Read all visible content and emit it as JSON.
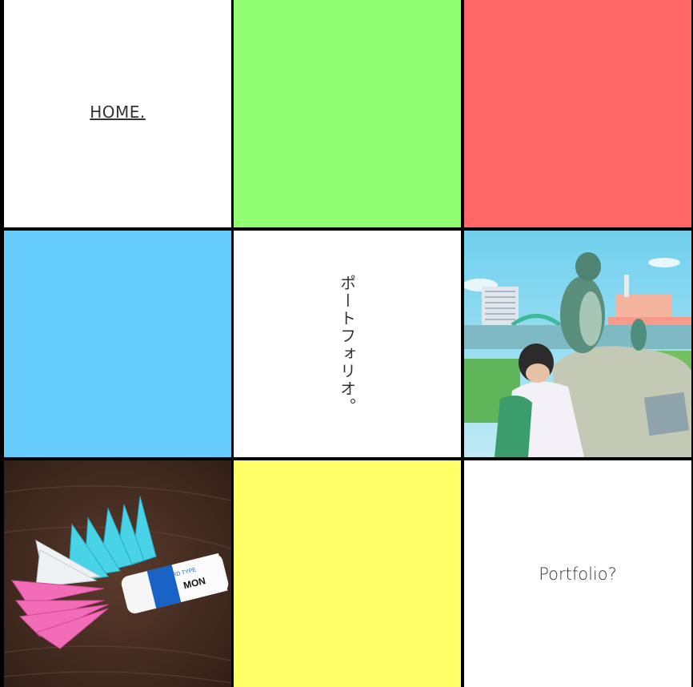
{
  "tiles": {
    "home": {
      "label": "HOME.",
      "bg": "#ffffff"
    },
    "green": {
      "bg": "#8ffe70"
    },
    "red": {
      "bg": "#ff6666"
    },
    "blue": {
      "bg": "#66cbfd"
    },
    "japanese": {
      "label": "ポートフォリオ。",
      "bg": "#ffffff"
    },
    "penguin_photo": {
      "icon": "photo-penguin-statue"
    },
    "origami_photo": {
      "icon": "photo-origami-cranes-eraser",
      "eraser_text_1": "HARD TYPE",
      "eraser_text_2": "MON"
    },
    "yellow": {
      "bg": "#ffff66"
    },
    "portfolio": {
      "label": "Portfolio?",
      "bg": "#ffffff"
    }
  }
}
